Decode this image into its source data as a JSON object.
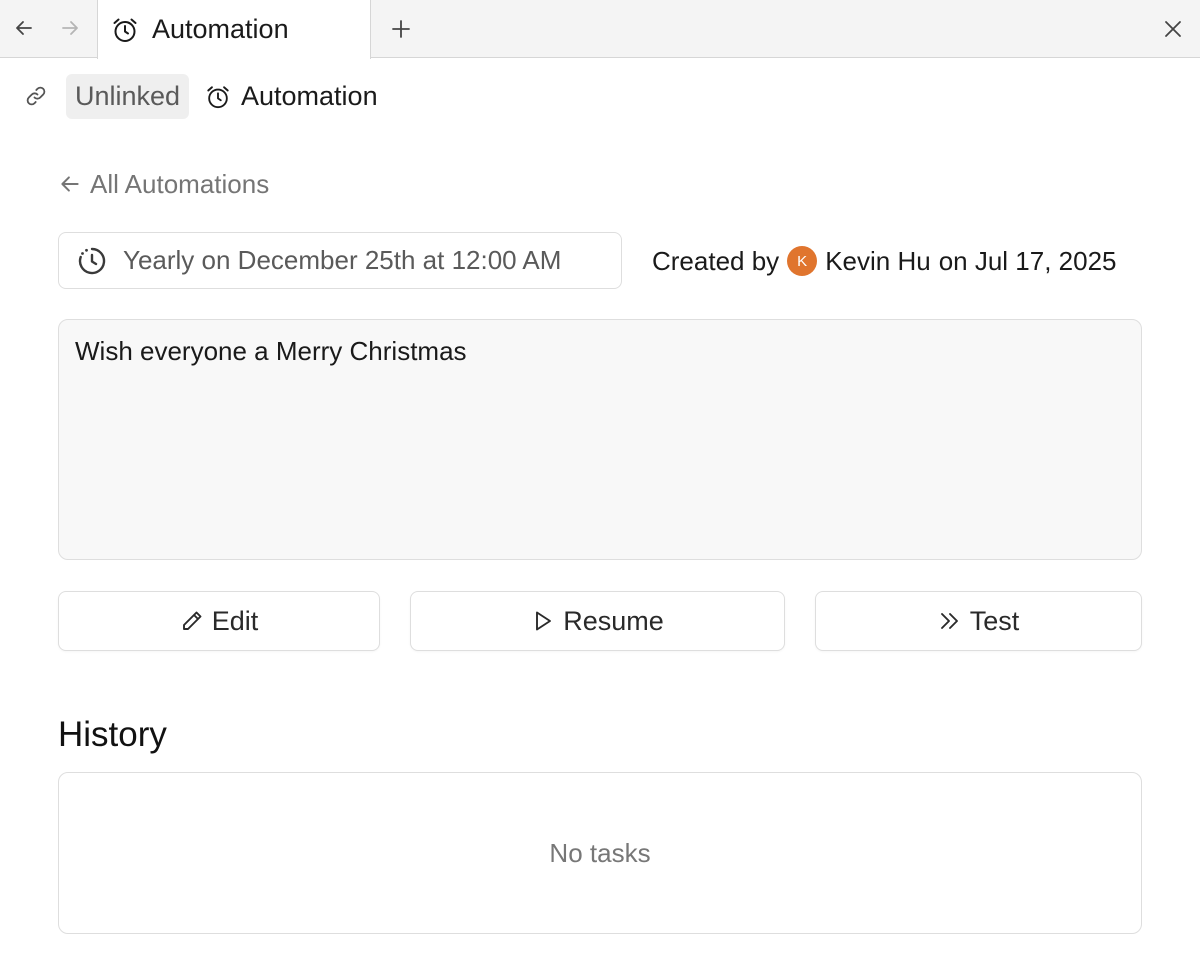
{
  "tabbar": {
    "tab_title": "Automation",
    "icons": [
      "arrow-left-icon",
      "arrow-right-icon",
      "alarm-clock-icon",
      "plus-icon",
      "close-icon"
    ]
  },
  "breadcrumb": {
    "unlinked_label": "Unlinked",
    "page_label": "Automation"
  },
  "back": {
    "label": "All Automations"
  },
  "schedule": {
    "label": "Yearly on December 25th at 12:00 AM"
  },
  "creator": {
    "prefix": "Created by",
    "avatar_initial": "K",
    "name": "Kevin Hu",
    "date_text": "on Jul 17, 2025",
    "avatar_color": "#e0752e"
  },
  "prompt": {
    "text": "Wish everyone a Merry Christmas"
  },
  "actions": {
    "edit_label": "Edit",
    "resume_label": "Resume",
    "test_label": "Test"
  },
  "history": {
    "title": "History",
    "empty_text": "No tasks"
  }
}
